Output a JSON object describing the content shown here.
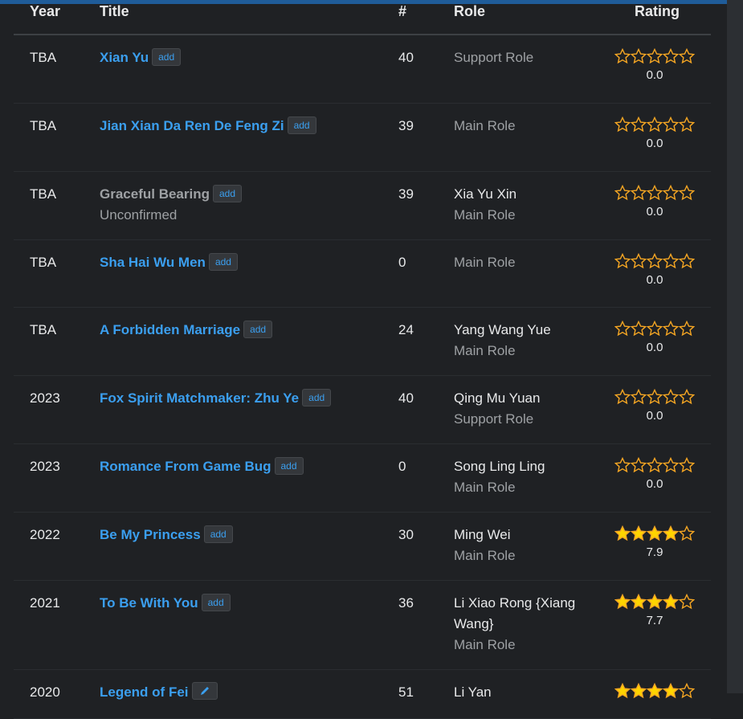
{
  "header": {
    "year": "Year",
    "title": "Title",
    "num": "#",
    "role": "Role",
    "rating": "Rating"
  },
  "add_label": "add",
  "colors": {
    "link": "#3b9fef",
    "star": "#f5a623",
    "star_fill": "#ffd400",
    "bg": "#1f2124"
  },
  "rows": [
    {
      "year": "TBA",
      "title": "Xian Yu",
      "linked": true,
      "unconfirmed": "",
      "num": "40",
      "char": "",
      "role": "Support Role",
      "score": "0.0",
      "stars": 0
    },
    {
      "year": "TBA",
      "title": "Jian Xian Da Ren De Feng Zi",
      "linked": true,
      "unconfirmed": "",
      "num": "39",
      "char": "",
      "role": "Main Role",
      "score": "0.0",
      "stars": 0
    },
    {
      "year": "TBA",
      "title": "Graceful Bearing",
      "linked": false,
      "unconfirmed": "Unconfirmed",
      "num": "39",
      "char": "Xia Yu Xin",
      "role": "Main Role",
      "score": "0.0",
      "stars": 0
    },
    {
      "year": "TBA",
      "title": "Sha Hai Wu Men",
      "linked": true,
      "unconfirmed": "",
      "num": "0",
      "char": "",
      "role": "Main Role",
      "score": "0.0",
      "stars": 0
    },
    {
      "year": "TBA",
      "title": "A Forbidden Marriage",
      "linked": true,
      "unconfirmed": "",
      "num": "24",
      "char": "Yang Wang Yue",
      "role": "Main Role",
      "score": "0.0",
      "stars": 0
    },
    {
      "year": "2023",
      "title": "Fox Spirit Matchmaker: Zhu Ye",
      "linked": true,
      "unconfirmed": "",
      "num": "40",
      "char": "Qing Mu Yuan",
      "role": "Support Role",
      "score": "0.0",
      "stars": 0
    },
    {
      "year": "2023",
      "title": "Romance From Game Bug",
      "linked": true,
      "unconfirmed": "",
      "num": "0",
      "char": "Song Ling Ling",
      "role": "Main Role",
      "score": "0.0",
      "stars": 0
    },
    {
      "year": "2022",
      "title": "Be My Princess",
      "linked": true,
      "unconfirmed": "",
      "num": "30",
      "char": "Ming Wei",
      "role": "Main Role",
      "score": "7.9",
      "stars": 4
    },
    {
      "year": "2021",
      "title": "To Be With You",
      "linked": true,
      "unconfirmed": "",
      "num": "36",
      "char": "Li Xiao Rong {Xiang Wang}",
      "role": "Main Role",
      "score": "7.7",
      "stars": 4
    },
    {
      "year": "2020",
      "title": "Legend of Fei",
      "linked": true,
      "unconfirmed": "",
      "num": "51",
      "char": "Li Yan",
      "role": "",
      "score": "",
      "stars": 4,
      "edit": true
    }
  ]
}
